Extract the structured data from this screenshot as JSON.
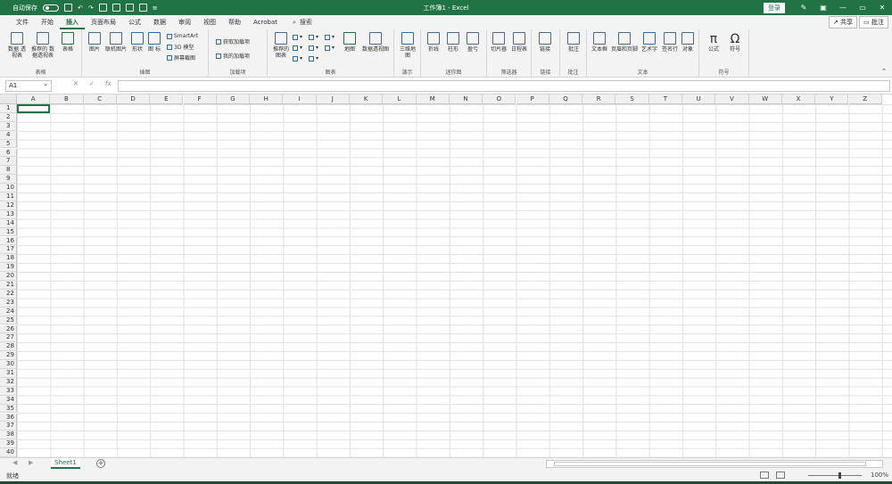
{
  "titlebar": {
    "autosave": "自动保存",
    "title": "工作簿1 - Excel",
    "login": "登录",
    "min": "—",
    "restore": "▭",
    "close": "✕"
  },
  "menu": {
    "tabs": [
      "文件",
      "开始",
      "插入",
      "页面布局",
      "公式",
      "数据",
      "审阅",
      "视图",
      "帮助",
      "Acrobat"
    ],
    "active": "插入",
    "search": "搜索",
    "share": "共享",
    "comment": "批注"
  },
  "ribbon": {
    "groups": [
      "表格",
      "插图",
      "加载项",
      "图表",
      "演示",
      "迷你图",
      "筛选器",
      "链接",
      "批注",
      "文本",
      "符号"
    ],
    "buttons": {
      "pivot": "数据\n透视表",
      "recpivot": "推荐的\n数据透视表",
      "table": "表格",
      "picture": "图片",
      "online": "联机图片",
      "shapes": "形状",
      "icons": "图\n标",
      "smartart": "SmartArt",
      "model3d": "3D 模型",
      "screenshot": "屏幕截图",
      "getaddin": "获取加载项",
      "myaddin": "我的加载项",
      "recchart": "推荐的\n图表",
      "map": "地图",
      "pivotchart": "数据透视图",
      "map3d": "三维地\n图",
      "line": "折线",
      "column": "柱形",
      "winloss": "盈亏",
      "slicer": "切片器",
      "timeline": "日程表",
      "link": "链接",
      "comment": "批注",
      "textbox": "文本框",
      "header": "页眉和页脚",
      "wordart": "艺术字",
      "signature": "签名行",
      "object": "对象",
      "equation": "公式",
      "symbol": "符号"
    }
  },
  "formula": {
    "namebox": "A1",
    "fx": "fx"
  },
  "columns": [
    "A",
    "B",
    "C",
    "D",
    "E",
    "F",
    "G",
    "H",
    "I",
    "J",
    "K",
    "L",
    "M",
    "N",
    "O",
    "P",
    "Q",
    "R",
    "S",
    "T",
    "U",
    "V",
    "W",
    "X",
    "Y",
    "Z"
  ],
  "rows": [
    "1",
    "2",
    "3",
    "4",
    "5",
    "6",
    "7",
    "8",
    "9",
    "10",
    "11",
    "12",
    "13",
    "14",
    "15",
    "16",
    "17",
    "18",
    "19",
    "20",
    "21",
    "22",
    "23",
    "24",
    "25",
    "26",
    "27",
    "28",
    "29",
    "30",
    "31",
    "32",
    "33",
    "34",
    "35",
    "36",
    "37",
    "38",
    "39",
    "40"
  ],
  "sheets": {
    "tab": "Sheet1",
    "add": "+"
  },
  "status": {
    "text": "就绪",
    "zoom": "100%"
  }
}
